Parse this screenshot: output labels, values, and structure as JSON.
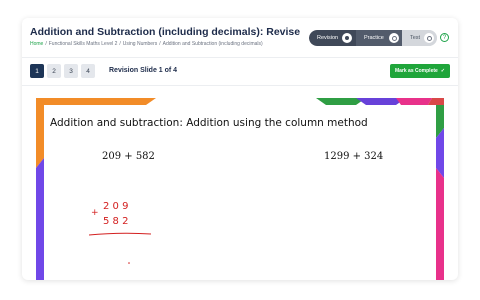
{
  "header": {
    "title": "Addition and Subtraction (including decimals): Revise",
    "breadcrumb": [
      "Home",
      "Functional Skills Maths Level 2",
      "Using Numbers",
      "Addition and Subtraction (including decimals)"
    ]
  },
  "modes": {
    "revision": "Revision",
    "practice": "Practice",
    "test": "Test"
  },
  "help_symbol": "?",
  "slides": {
    "buttons": [
      "1",
      "2",
      "3",
      "4"
    ],
    "info": "Revision Slide 1 of 4"
  },
  "complete_button": {
    "label": "Mark as Complete",
    "check": "✓"
  },
  "slide": {
    "heading": "Addition and subtraction: Addition using the column method",
    "expr1": "209 + 582",
    "expr2": "1299 + 324",
    "handwriting": {
      "plus": "+",
      "top": "2 0 9",
      "bottom": "5 8 2"
    }
  },
  "colors": {
    "accent_green": "#1fa53a",
    "nav_active": "#1d3557",
    "handwriting": "#d32020"
  }
}
